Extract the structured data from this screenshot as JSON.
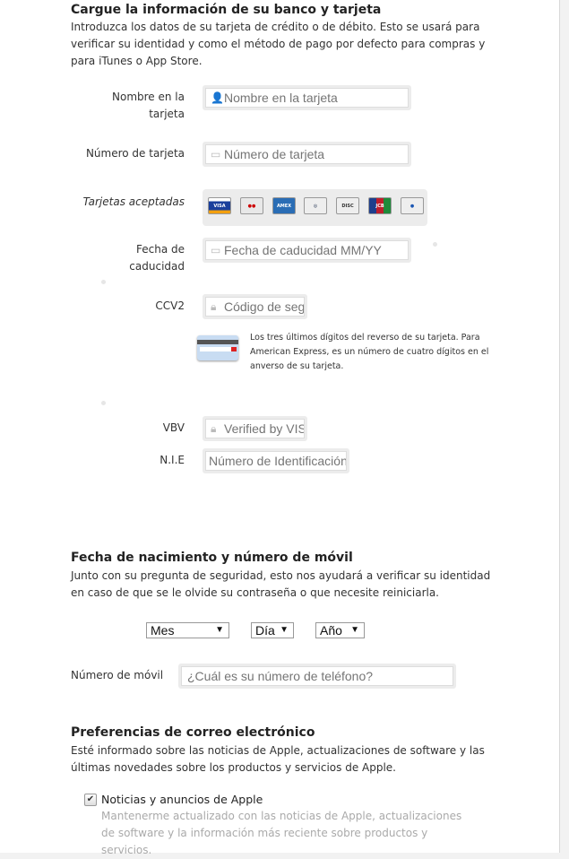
{
  "bank": {
    "title": "Cargue la información de su banco y tarjeta",
    "desc": "Introduzca los datos de su tarjeta de crédito o de débito. Esto se usará para verificar su identidad y como el método de pago por defecto para compras y para iTunes o App Store.",
    "name_label": "Nombre en la tarjeta",
    "name_placeholder": "Nombre en la tarjeta",
    "number_label": "Número de tarjeta",
    "number_placeholder": "Número de tarjeta",
    "accepted_label": "Tarjetas aceptadas",
    "cards": [
      "VISA",
      "MasterCard",
      "American Express",
      "Diners Club",
      "Discover",
      "JCB",
      "Maestro"
    ],
    "expiry_label": "Fecha de caducidad",
    "expiry_placeholder": "Fecha de caducidad MM/YY",
    "ccv_label": "CCV2",
    "ccv_placeholder": "Código de seg",
    "ccv_help": "Los tres últimos dígitos del reverso de su tarjeta. Para American Express, es un número de cuatro dígitos en el anverso de su tarjeta.",
    "vbv_label": "VBV",
    "vbv_placeholder": "Verified by VIS",
    "nie_label": "N.I.E",
    "nie_placeholder": "Número de Identificación"
  },
  "birth": {
    "title": "Fecha de nacimiento y número de móvil",
    "desc": "Junto con su pregunta de seguridad, esto nos ayudará a verificar su identidad en caso de que se le olvide su contraseña o que necesite reiniciarla.",
    "month": "Mes",
    "day": "Día",
    "year": "Año",
    "mobile_label": "Número de móvil",
    "mobile_placeholder": "¿Cuál es su número de teléfono?"
  },
  "email": {
    "title": "Preferencias de correo electrónico",
    "desc": "Esté informado sobre las noticias de Apple, actualizaciones de software y las últimas novedades sobre los productos y servicios de Apple.",
    "news_label": "Noticias y anuncios de Apple",
    "news_checked": true,
    "news_desc": "Mantenerme actualizado con las noticias de Apple, actualizaciones de software y la información más reciente sobre productos y servicios."
  }
}
